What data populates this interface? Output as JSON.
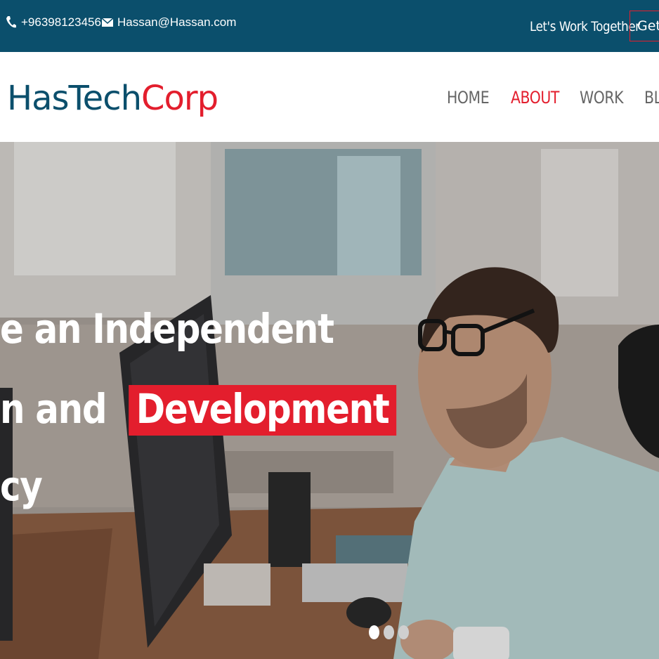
{
  "topbar": {
    "phone": "+96398123456",
    "email": "Hassan@Hassan.com",
    "tagline": "Let's Work Together",
    "cta_label": "Get"
  },
  "brand": {
    "part1": "HasTech",
    "part2": "Corp"
  },
  "nav": {
    "items": [
      {
        "label": "HOME"
      },
      {
        "label": "ABOUT"
      },
      {
        "label": "WORK"
      },
      {
        "label": "BL"
      }
    ],
    "active_item": "ABOUT"
  },
  "hero": {
    "line1": "e an Independent",
    "line2_prefix": "n and",
    "line2_highlight": "Development",
    "line3": "cy",
    "slides": 3,
    "active_slide": 1
  },
  "colors": {
    "brand_dark": "#0b4f6c",
    "accent_red": "#e31e2d",
    "nav_text": "#666666"
  },
  "icons": {
    "phone": "phone-icon",
    "email": "envelope-icon"
  }
}
